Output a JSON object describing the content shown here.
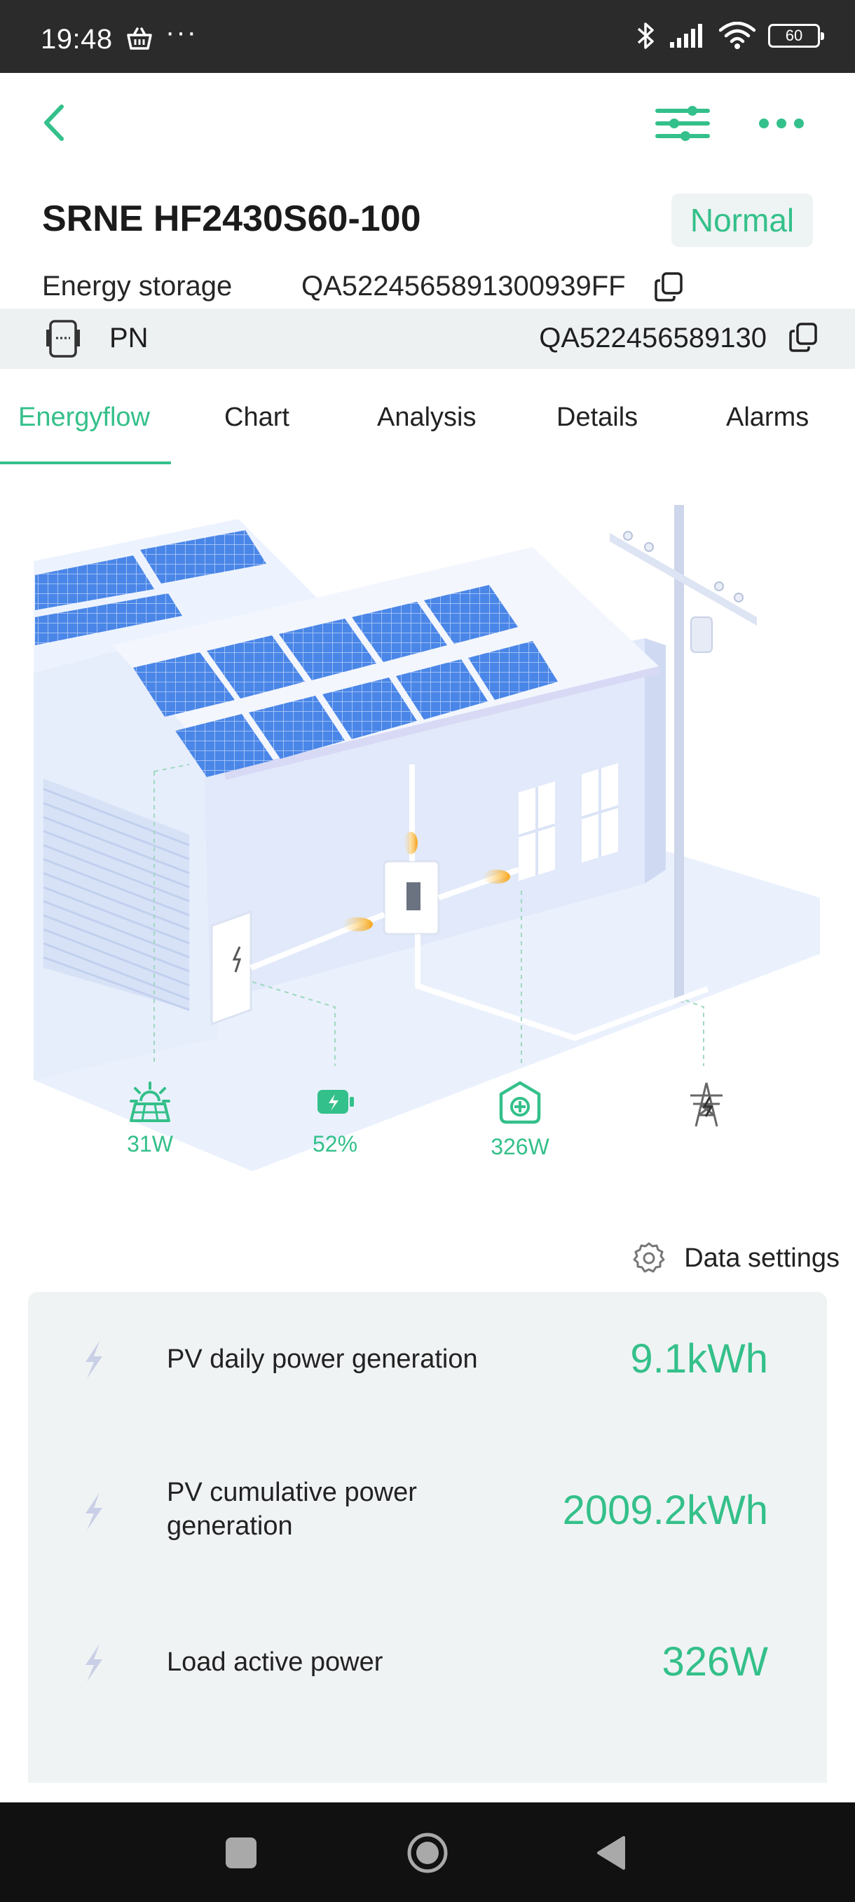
{
  "status_bar": {
    "time": "19:48",
    "overflow": "···",
    "battery": "60",
    "icons": [
      "shopping-basket-icon",
      "bluetooth-icon",
      "signal-icon",
      "wifi-icon",
      "battery-icon"
    ]
  },
  "header": {
    "device_title": "SRNE HF2430S60-100",
    "status": "Normal",
    "storage_label": "Energy storage",
    "storage_serial": "QA5224565891300939FF",
    "pn_label": "PN",
    "pn_value": "QA522456589130"
  },
  "tabs": [
    {
      "label": "Energyflow",
      "active": true
    },
    {
      "label": "Chart",
      "active": false
    },
    {
      "label": "Analysis",
      "active": false
    },
    {
      "label": "Details",
      "active": false
    },
    {
      "label": "Alarms",
      "active": false
    }
  ],
  "energy_flow": {
    "pv": {
      "value": "31W",
      "icon": "solar-panel-icon"
    },
    "battery": {
      "value": "52%",
      "icon": "battery-charging-icon"
    },
    "load": {
      "value": "326W",
      "icon": "home-load-icon"
    },
    "grid": {
      "icon": "power-tower-icon"
    }
  },
  "data_settings": {
    "label": "Data settings",
    "icon": "gear-icon"
  },
  "data_rows": [
    {
      "label": "PV daily power generation",
      "value": "9.1kWh"
    },
    {
      "label": "PV cumulative power generation",
      "value": "2009.2kWh"
    },
    {
      "label": "Load active power",
      "value": "326W"
    }
  ],
  "colors": {
    "accent": "#34c08a",
    "panel_bg": "#f0f3f4",
    "status_bar": "#2b2b2b",
    "nav_bar": "#111111",
    "solar_blue": "#4a86e8"
  }
}
